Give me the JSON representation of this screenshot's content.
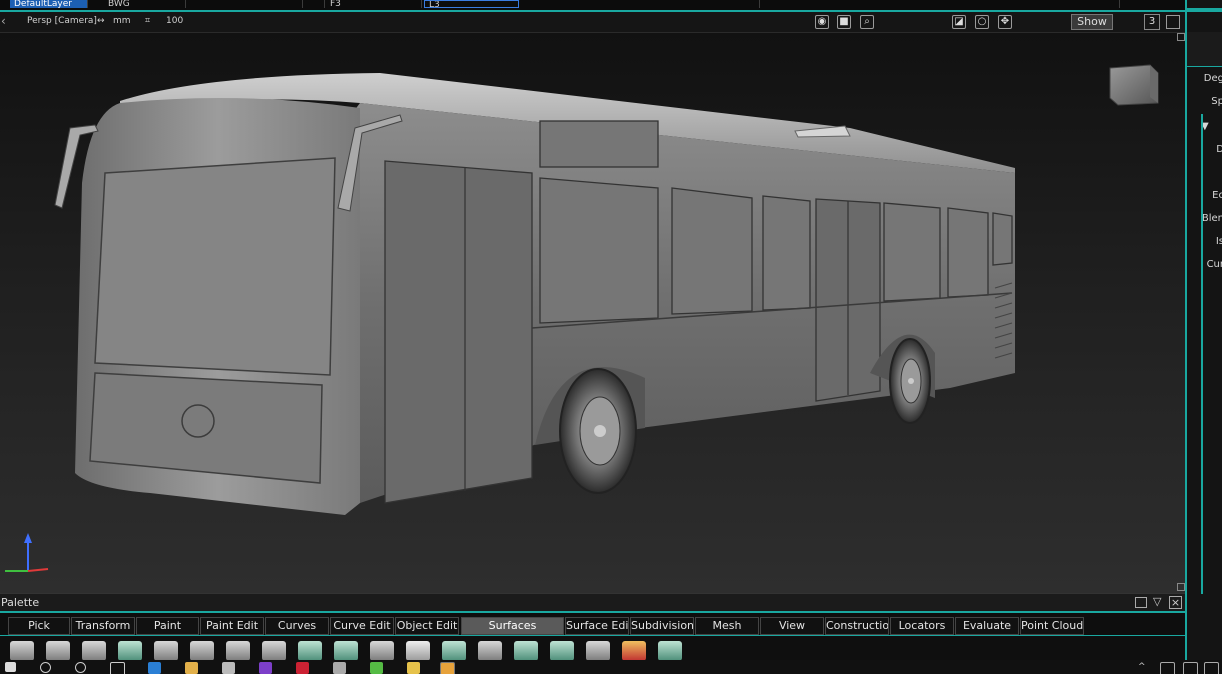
{
  "layers": [
    "DefaultLayer",
    "BWG",
    "",
    "",
    "F3",
    "L3",
    "",
    ""
  ],
  "viewport": {
    "camera_label": "Persp [Camera]",
    "units": "mm",
    "scale": "100",
    "show_button": "Show",
    "view_number": "3"
  },
  "right_panel": {
    "labels": [
      "Deg",
      "Sp",
      "▼",
      "D",
      "Ec",
      "Blen",
      "Is",
      "Cur"
    ]
  },
  "palette": {
    "title": "Palette",
    "tabs": [
      "Pick",
      "Transform",
      "Paint",
      "Paint Edit",
      "Curves",
      "Curve Edit",
      "Object Edit",
      "Surfaces",
      "Surface Edit",
      "Subdivision",
      "Mesh",
      "View",
      "Construction",
      "Locators",
      "Evaluate",
      "Point Clouds"
    ],
    "active_tab": "Surfaces"
  },
  "colors": {
    "accent": "#19a8a0",
    "selected_layer": "#1c5fb3",
    "active_tab": "#5a5a5a"
  }
}
